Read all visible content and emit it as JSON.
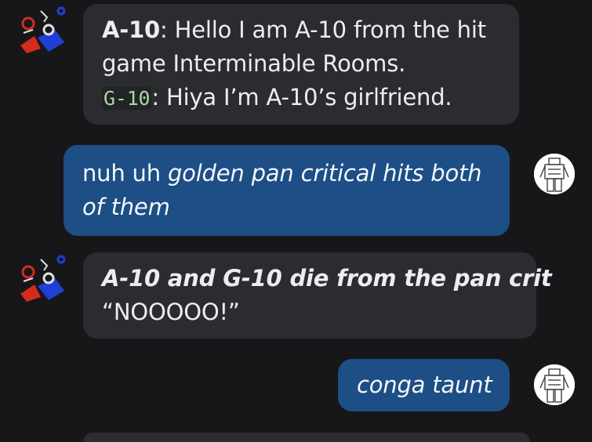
{
  "messages": [
    {
      "role": "assistant",
      "lines": [
        {
          "speaker": "A-10",
          "text": ": Hello I am A-10 from the hit"
        },
        {
          "text": "game Interminable Rooms."
        },
        {
          "code": "G-10",
          "text": ": Hiya I’m A-10’s girlfriend."
        }
      ]
    },
    {
      "role": "user",
      "lines": [
        {
          "plain": "nuh uh ",
          "italic": "golden pan critical hits both"
        },
        {
          "italic": "of them"
        }
      ]
    },
    {
      "role": "assistant",
      "lines": [
        {
          "bold_italic": "A-10 and G-10 die from the pan crit"
        },
        {
          "text": "“NOOOOO!”"
        }
      ]
    },
    {
      "role": "user",
      "lines": [
        {
          "italic": "conga taunt"
        }
      ]
    }
  ],
  "avatars": {
    "bot": "character-avatar-icon",
    "user": "robot-sketch-avatar-icon"
  },
  "colors": {
    "background": "#17171a",
    "bot_bubble": "#2b2c30",
    "user_bubble": "#1d4e85",
    "code_text": "#a6d6a3"
  }
}
